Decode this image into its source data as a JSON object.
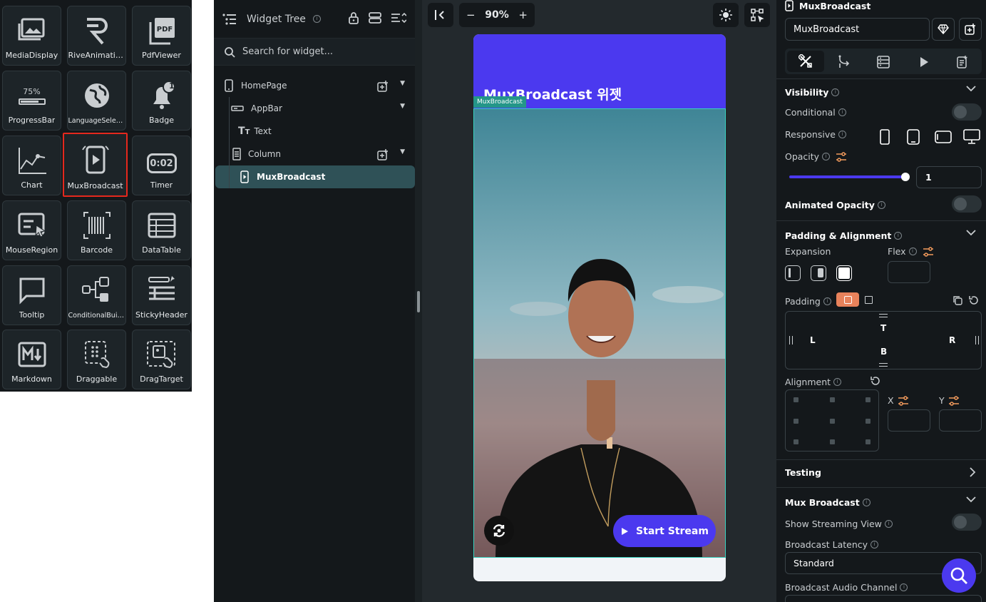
{
  "palette": {
    "tiles": [
      {
        "label": "MediaDisplay",
        "icon": "image-gallery-icon"
      },
      {
        "label": "RiveAnimation",
        "icon": "rive-logo-icon"
      },
      {
        "label": "PdfViewer",
        "icon": "pdf-file-icon"
      },
      {
        "label": "ProgressBar",
        "icon": "progress-bar-icon",
        "icon_text": "75%",
        "progress": 75
      },
      {
        "label": "LanguageSelector",
        "icon": "globe-icon"
      },
      {
        "label": "Badge",
        "icon": "bell-badge-icon",
        "icon_text": "1"
      },
      {
        "label": "Chart",
        "icon": "line-chart-icon"
      },
      {
        "label": "MuxBroadcast",
        "icon": "phone-play-icon"
      },
      {
        "label": "Timer",
        "icon": "timer-icon",
        "icon_text": "0:02"
      },
      {
        "label": "MouseRegion",
        "icon": "cursor-region-icon"
      },
      {
        "label": "Barcode",
        "icon": "barcode-icon"
      },
      {
        "label": "DataTable",
        "icon": "data-table-icon"
      },
      {
        "label": "Tooltip",
        "icon": "speech-bubble-icon"
      },
      {
        "label": "ConditionalBuild...",
        "icon": "conditional-flow-icon"
      },
      {
        "label": "StickyHeader",
        "icon": "sticky-header-icon"
      },
      {
        "label": "Markdown",
        "icon": "markdown-icon"
      },
      {
        "label": "Draggable",
        "icon": "draggable-icon"
      },
      {
        "label": "DragTarget",
        "icon": "drag-target-icon"
      }
    ],
    "selected": "MuxBroadcast"
  },
  "tree": {
    "title": "Widget Tree",
    "search_placeholder": "Search for widget...",
    "nodes": [
      {
        "label": "HomePage",
        "icon": "phone-icon"
      },
      {
        "label": "AppBar",
        "icon": "appbar-icon"
      },
      {
        "label": "Text",
        "icon": "text-icon"
      },
      {
        "label": "Column",
        "icon": "column-icon"
      },
      {
        "label": "MuxBroadcast",
        "icon": "phone-play-icon"
      }
    ]
  },
  "canvas": {
    "zoom": "90%",
    "appbar_title": "MuxBroadcast 위젯",
    "widget_tag": "MuxBroadcast",
    "start_button": "Start Stream",
    "colors": {
      "primary": "#4b39ef",
      "selection": "#39d2c0"
    }
  },
  "props": {
    "widget_name": "MuxBroadcast",
    "name_value": "MuxBroadcast",
    "visibility": {
      "title": "Visibility",
      "conditional": "Conditional",
      "responsive": "Responsive",
      "opacity": "Opacity",
      "opacity_value": "1",
      "animated_opacity": "Animated Opacity"
    },
    "padding_alignment": {
      "title": "Padding & Alignment",
      "expansion": "Expansion",
      "flex": "Flex",
      "padding": "Padding",
      "t": "T",
      "b": "B",
      "l": "L",
      "r": "R",
      "alignment": "Alignment",
      "x": "X",
      "y": "Y"
    },
    "testing": "Testing",
    "mux": {
      "title": "Mux Broadcast",
      "show_streaming_view": "Show Streaming View",
      "broadcast_latency": "Broadcast Latency",
      "latency_value": "Standard",
      "audio_channel": "Broadcast Audio Channel"
    }
  }
}
